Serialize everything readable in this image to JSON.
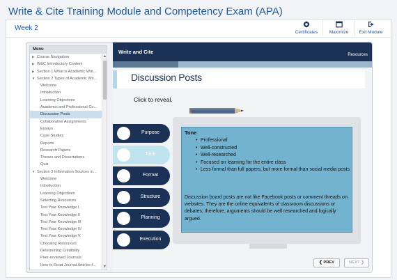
{
  "page": {
    "title": "Write & Cite Training Module and Competency Exam (APA)"
  },
  "header": {
    "week": "Week 2",
    "tools": [
      {
        "label": "Certificates",
        "icon": "certificate-icon"
      },
      {
        "label": "Maximize",
        "icon": "maximize-icon"
      },
      {
        "label": "Exit Module",
        "icon": "exit-icon"
      }
    ]
  },
  "menu": {
    "heading": "Menu",
    "items": [
      {
        "label": "Course Navigation",
        "level": 0,
        "expandable": true
      },
      {
        "label": "W&C Introductory Content",
        "level": 0,
        "expandable": true
      },
      {
        "label": "Section 1 What is Academic Writ...",
        "level": 0,
        "expandable": true
      },
      {
        "label": "Section 2 Types of Academic Wri...",
        "level": 0,
        "expandable": true,
        "expanded": true
      },
      {
        "label": "Welcome",
        "level": 1
      },
      {
        "label": "Introduction",
        "level": 1
      },
      {
        "label": "Learning Objectives",
        "level": 1
      },
      {
        "label": "Academic and Professional Co...",
        "level": 1
      },
      {
        "label": "Discussion Posts",
        "level": 1,
        "active": true
      },
      {
        "label": "Collaborative Assignments",
        "level": 1
      },
      {
        "label": "Essays",
        "level": 1
      },
      {
        "label": "Case Studies",
        "level": 1
      },
      {
        "label": "Reports",
        "level": 1
      },
      {
        "label": "Research Papers",
        "level": 1
      },
      {
        "label": "Theses and Dissertations",
        "level": 1
      },
      {
        "label": "Quiz",
        "level": 1
      },
      {
        "label": "Section 3 Information Sources in...",
        "level": 0,
        "expandable": true,
        "expanded": true
      },
      {
        "label": "Welcome",
        "level": 1
      },
      {
        "label": "Introduction",
        "level": 1
      },
      {
        "label": "Learning Objectives",
        "level": 1
      },
      {
        "label": "Selecting Resources",
        "level": 1
      },
      {
        "label": "Test Your Knowledge I",
        "level": 1
      },
      {
        "label": "Test Your Knowledge II",
        "level": 1
      },
      {
        "label": "Test Your Knowledge III",
        "level": 1
      },
      {
        "label": "Test Your Knowledge IV",
        "level": 1
      },
      {
        "label": "Test Your Knowledge V",
        "level": 1
      },
      {
        "label": "Choosing Resources",
        "level": 1
      },
      {
        "label": "Determining Credibility",
        "level": 1
      },
      {
        "label": "Peer-reviewed Journals",
        "level": 1
      },
      {
        "label": "How to Read Journal Articles f...",
        "level": 1
      }
    ]
  },
  "slide": {
    "bar_title": "Write and Cite",
    "resources": "Resources",
    "progress": 0.25,
    "heading": "Discussion Posts",
    "instruction": "Click to reveal.",
    "tabs": [
      "Purpose",
      "Tone",
      "Format",
      "Structure",
      "Planning",
      "Execution"
    ],
    "active_tab": 1,
    "panel": {
      "title": "Tone",
      "bullets": [
        "Professional",
        "Well-constructed",
        "Well-researched",
        "Focused on learning for the entire class",
        "Less formal than full papers, but more formal than social media posts"
      ],
      "paragraph": "Discussion board posts are not like Facebook posts or comment threads on websites. They are the online equivalents of classroom discussions or debates; therefore, arguments should be well researched and logically argued."
    }
  },
  "nav": {
    "prev": "❮ PREV",
    "next": "NEXT ❯"
  },
  "colors": {
    "navy": "#1c3156",
    "accent_blue": "#1e5aa0",
    "panel_teal": "#73b3cf",
    "active_tab": "#bfe4ef"
  }
}
